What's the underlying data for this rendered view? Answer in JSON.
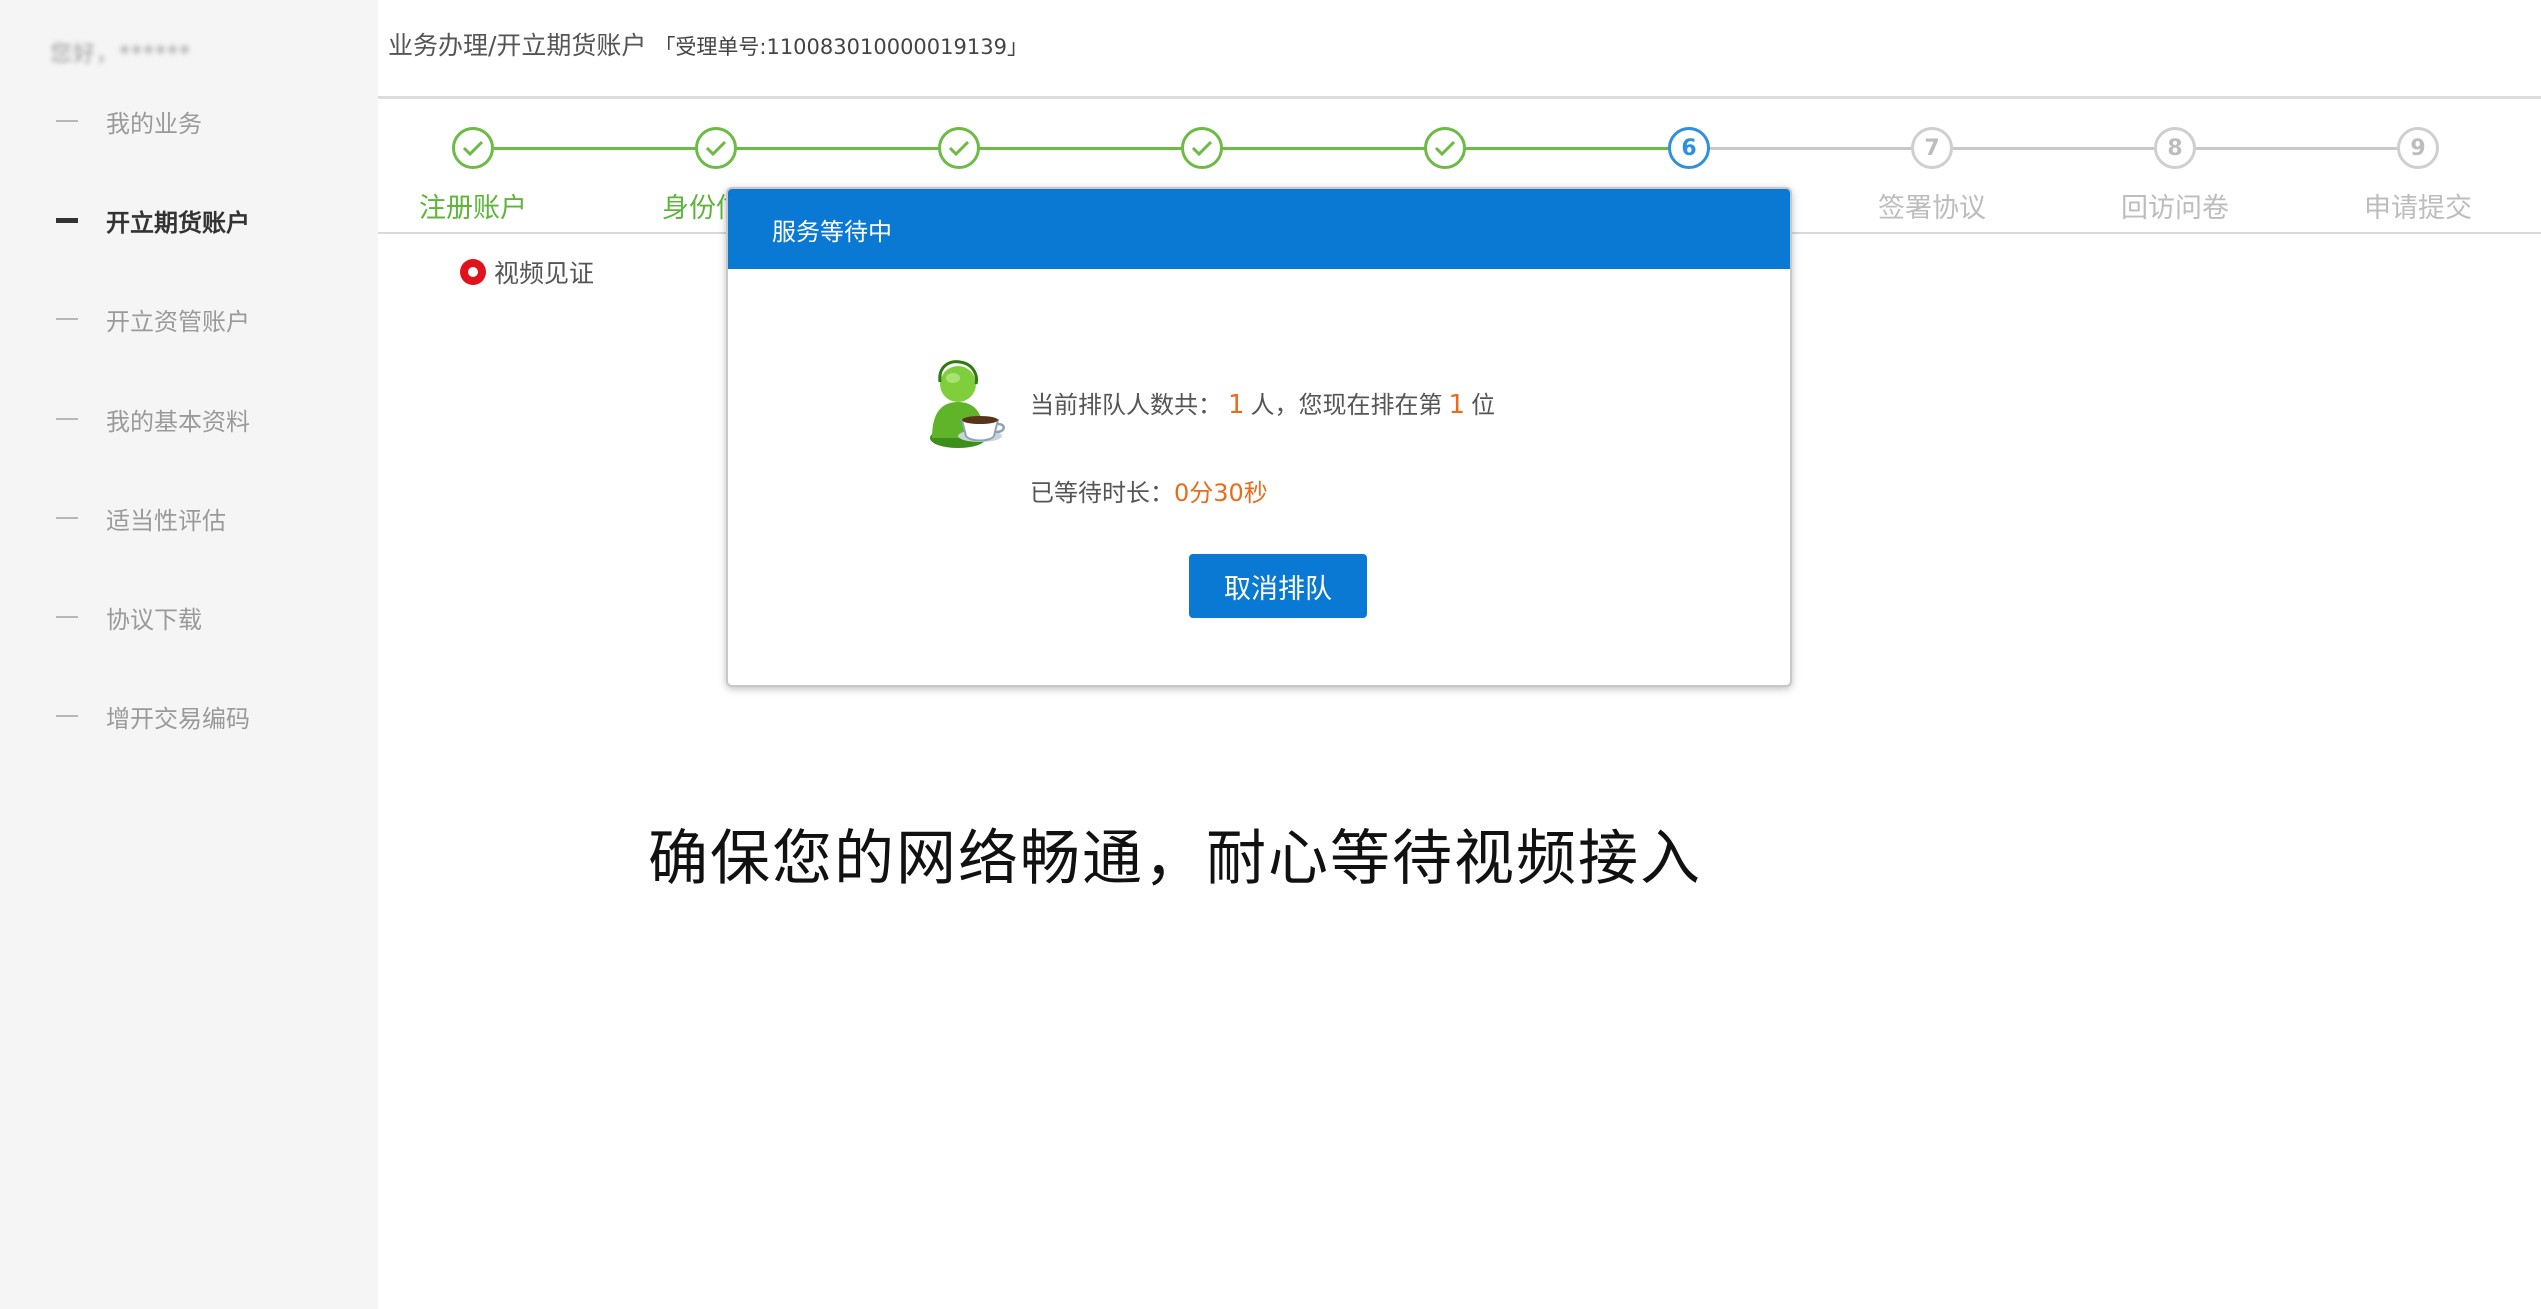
{
  "sidebar": {
    "greeting": "您好，******",
    "items": [
      {
        "label": "我的业务",
        "active": false
      },
      {
        "label": "开立期货账户",
        "active": true
      },
      {
        "label": "开立资管账户",
        "active": false
      },
      {
        "label": "我的基本资料",
        "active": false
      },
      {
        "label": "适当性评估",
        "active": false
      },
      {
        "label": "协议下载",
        "active": false
      },
      {
        "label": "增开交易编码",
        "active": false
      }
    ]
  },
  "header": {
    "breadcrumb": "业务办理/开立期货账户",
    "order_label": "「受理单号:110083010000019139」"
  },
  "steps": [
    {
      "label": "注册账户",
      "status": "done",
      "number": ""
    },
    {
      "label": "身份信息",
      "status": "done",
      "number": ""
    },
    {
      "label": "",
      "status": "done",
      "number": ""
    },
    {
      "label": "",
      "status": "done",
      "number": ""
    },
    {
      "label": "",
      "status": "done",
      "number": ""
    },
    {
      "label": "",
      "status": "current",
      "number": "6"
    },
    {
      "label": "签署协议",
      "status": "todo",
      "number": "7"
    },
    {
      "label": "回访问卷",
      "status": "todo",
      "number": "8"
    },
    {
      "label": "申请提交",
      "status": "todo",
      "number": "9"
    }
  ],
  "witness": {
    "label": "视频见证"
  },
  "modal": {
    "title": "服务等待中",
    "queue_prefix": "当前排队人数共：",
    "queue_count": "1",
    "queue_middle": "人，您现在排在第",
    "queue_position": "1",
    "queue_suffix": "位",
    "wait_prefix": "已等待时长：",
    "wait_time": "0分30秒",
    "cancel_label": "取消排队"
  },
  "notice": "确保您的网络畅通，耐心等待视频接入",
  "colors": {
    "primary_blue": "#0a79d4",
    "step_done_green": "#6dba45",
    "highlight_orange": "#e96b1d",
    "witness_red": "#e0131d"
  }
}
